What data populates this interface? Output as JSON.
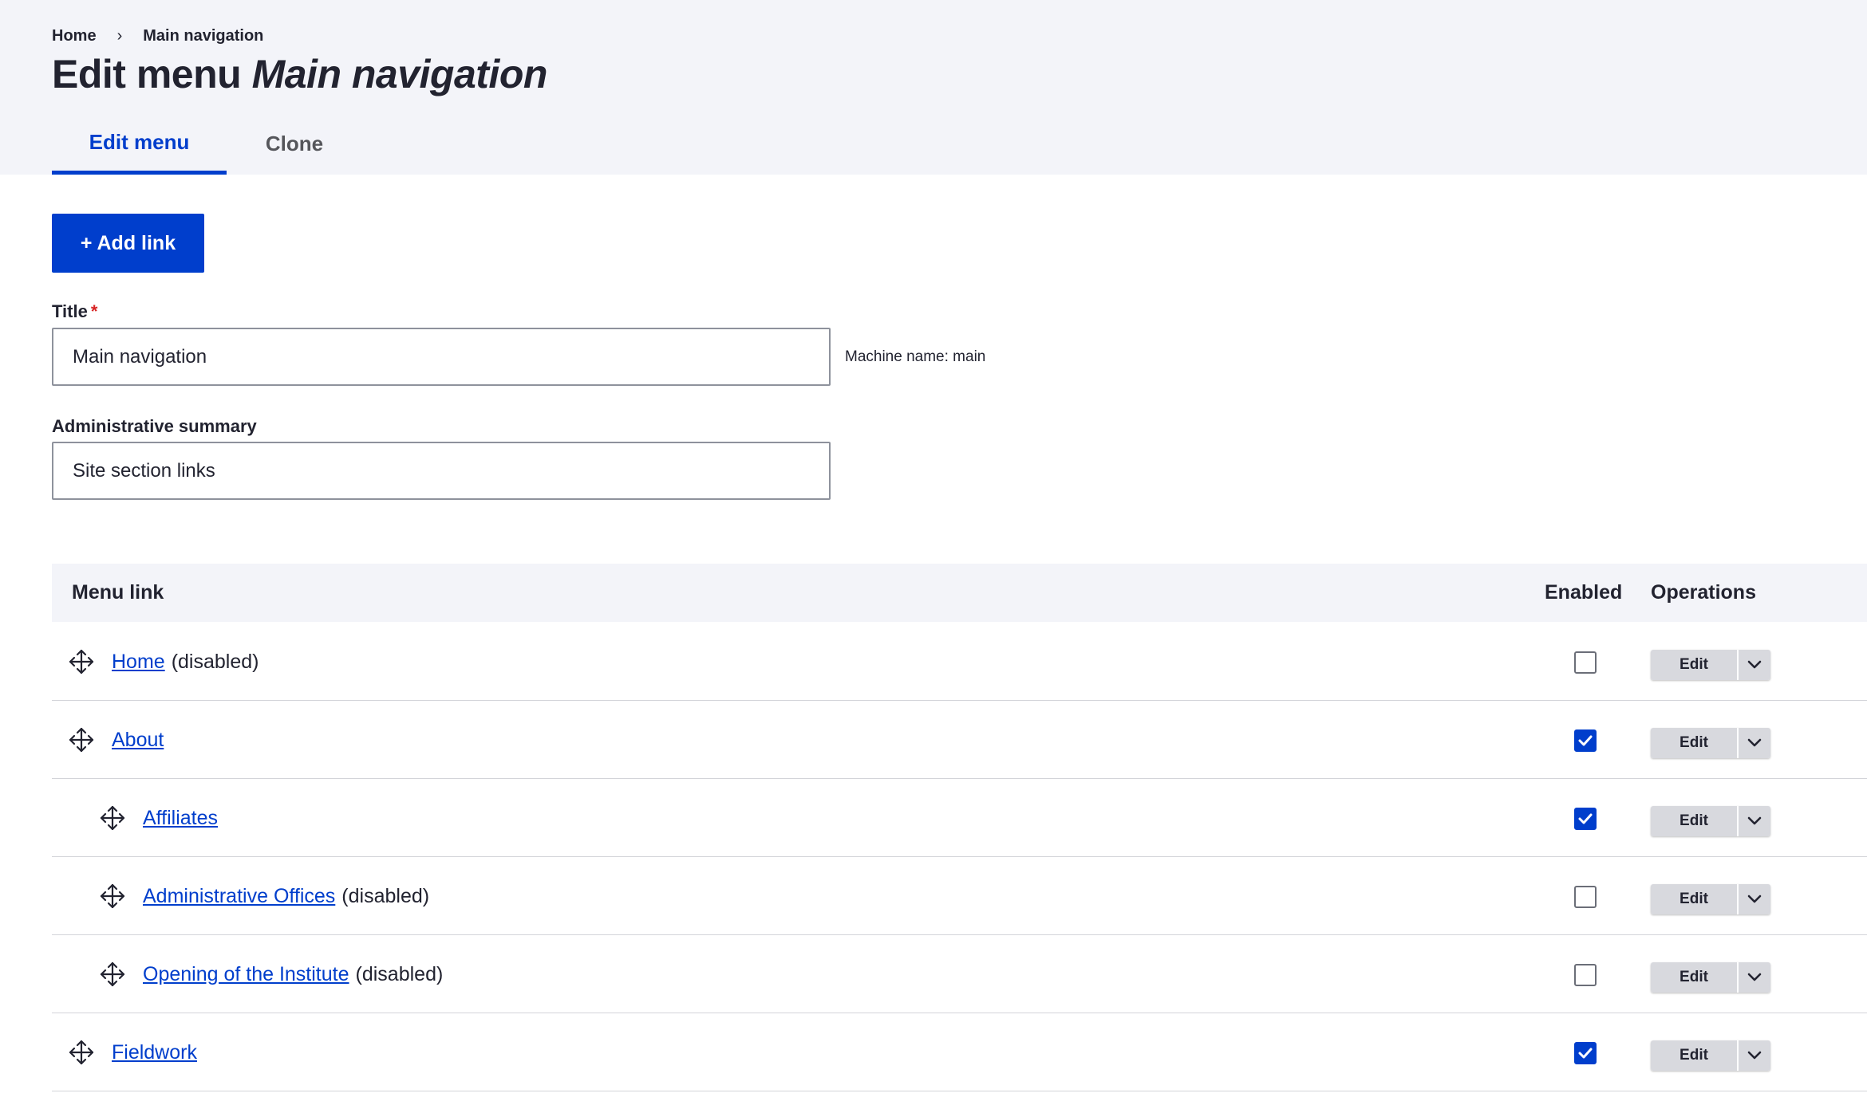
{
  "breadcrumb": {
    "items": [
      "Home",
      "Main navigation"
    ],
    "separator": "›"
  },
  "page_title": {
    "prefix": "Edit menu",
    "menu_name": "Main navigation"
  },
  "tabs": [
    {
      "label": "Edit menu",
      "active": true
    },
    {
      "label": "Clone",
      "active": false
    }
  ],
  "add_link_button": "+ Add link",
  "form": {
    "title_label": "Title",
    "required_marker": "*",
    "title_value": "Main navigation",
    "machine_name": "Machine name: main",
    "summary_label": "Administrative summary",
    "summary_value": "Site section links"
  },
  "table": {
    "headers": {
      "menu_link": "Menu link",
      "enabled": "Enabled",
      "operations": "Operations"
    },
    "rows": [
      {
        "title": "Home",
        "status": "(disabled)",
        "enabled": false,
        "level": 0,
        "op": "Edit"
      },
      {
        "title": "About",
        "status": "",
        "enabled": true,
        "level": 0,
        "op": "Edit"
      },
      {
        "title": "Affiliates",
        "status": "",
        "enabled": true,
        "level": 1,
        "op": "Edit"
      },
      {
        "title": "Administrative Offices",
        "status": "(disabled)",
        "enabled": false,
        "level": 1,
        "op": "Edit"
      },
      {
        "title": "Opening of the Institute",
        "status": "(disabled)",
        "enabled": false,
        "level": 1,
        "op": "Edit"
      },
      {
        "title": "Fieldwork",
        "status": "",
        "enabled": true,
        "level": 0,
        "op": "Edit"
      }
    ]
  },
  "icons": {
    "drag": "move-arrows-icon",
    "check": "checkmark-icon",
    "dropdown": "chevron-down-icon"
  },
  "colors": {
    "accent": "#003ecc",
    "header_bg": "#f3f4f9",
    "required": "#d72222",
    "button_grey": "#d8d9de"
  }
}
